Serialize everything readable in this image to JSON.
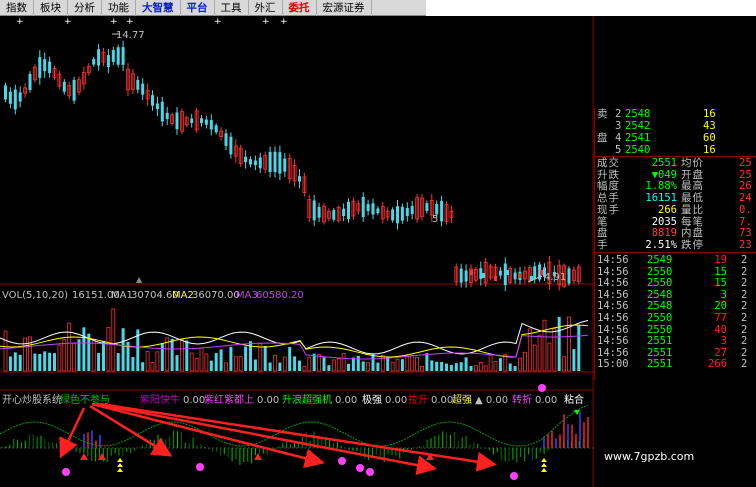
{
  "menu": [
    {
      "label": "指数",
      "style": "normal"
    },
    {
      "label": "板块",
      "style": "normal"
    },
    {
      "label": "分析",
      "style": "normal"
    },
    {
      "label": "功能",
      "style": "normal"
    },
    {
      "label": "大智慧",
      "style": "blue"
    },
    {
      "label": "平台",
      "style": "blue"
    },
    {
      "label": "工具",
      "style": "normal"
    },
    {
      "label": "外汇",
      "style": "normal"
    },
    {
      "label": "委托",
      "style": "red"
    },
    {
      "label": "宏源证券",
      "style": "normal"
    }
  ],
  "price_chart": {
    "high_label": "14.77",
    "low_label": "4.91",
    "small_label": "5"
  },
  "volume_panel": {
    "title": "VOL(5,10,20)",
    "vol_value": "16151.00",
    "ma1_label": "MA1",
    "ma1_value": "30704.60",
    "ma2_label": "MA2",
    "ma2_value": "36070.00",
    "ma3_label": "MA3",
    "ma3_value": "60580.20"
  },
  "indicator_panel": {
    "name": "开心炒股系统",
    "items": [
      {
        "label": "绿色不参与",
        "value": "",
        "color": "#00c000"
      },
      {
        "label": "紫阳快牛",
        "value": "0.00",
        "color": "#c000c0"
      },
      {
        "label": "紫红紫都上",
        "value": "0.00",
        "color": "#ff40ff"
      },
      {
        "label": "升浪超强机",
        "value": "0.00",
        "color": "#00ff00"
      },
      {
        "label": "极强",
        "value": "0.00",
        "color": "#ffffff"
      },
      {
        "label": "拉升",
        "value": "0.00",
        "color": "#ff0000"
      },
      {
        "label": "超强",
        "value": "▲ 0.00",
        "color": "#ffff00"
      },
      {
        "label": "转折",
        "value": "0.00",
        "color": "#ff40ff"
      },
      {
        "label": "粘合",
        "value": "",
        "color": "#ffffff"
      }
    ]
  },
  "orderbook": [
    {
      "side": "卖",
      "level": "2",
      "price": "2548",
      "vol": "16"
    },
    {
      "side": "",
      "level": "3",
      "price": "2542",
      "vol": "43"
    },
    {
      "side": "盘",
      "level": "4",
      "price": "2541",
      "vol": "60"
    },
    {
      "side": "",
      "level": "5",
      "price": "2540",
      "vol": "16"
    }
  ],
  "quote": [
    {
      "l": "成交",
      "v": "2551",
      "vc": "#00ff00",
      "l2": "均价",
      "v2": "25"
    },
    {
      "l": "升跌",
      "v": "▼049",
      "vc": "#00ff00",
      "l2": "开盘",
      "v2": "25"
    },
    {
      "l": "幅度",
      "v": "1.88%",
      "vc": "#00ff00",
      "l2": "最高",
      "v2": "26"
    },
    {
      "l": "总手",
      "v": "16151",
      "vc": "#00ffff",
      "l2": "最低",
      "v2": "24"
    },
    {
      "l": "现手",
      "v": "266",
      "vc": "#ffff00",
      "l2": "量比",
      "v2": "0."
    },
    {
      "l": "笔",
      "v": "2035",
      "vc": "#ffffff",
      "l2": "每笔",
      "v2": "7."
    },
    {
      "l": "盘",
      "v": "8819",
      "vc": "#ff4040",
      "l2": "内盘",
      "v2": "73"
    },
    {
      "l": "手",
      "v": "2.51%",
      "vc": "#ffffff",
      "l2": "跌停",
      "v2": "23"
    }
  ],
  "ticks": [
    {
      "t": "14:56",
      "p": "2549",
      "v": "19",
      "vc": "#ff2020",
      "d": "2"
    },
    {
      "t": "14:56",
      "p": "2550",
      "v": "15",
      "vc": "#00ff00",
      "d": "2"
    },
    {
      "t": "14:56",
      "p": "2550",
      "v": "15",
      "vc": "#00ff00",
      "d": "2"
    },
    {
      "t": "14:56",
      "p": "2548",
      "v": "3",
      "vc": "#00ff00",
      "d": "2"
    },
    {
      "t": "14:56",
      "p": "2548",
      "v": "20",
      "vc": "#00ff00",
      "d": "2"
    },
    {
      "t": "14:56",
      "p": "2550",
      "v": "77",
      "vc": "#ff2020",
      "d": "2"
    },
    {
      "t": "14:56",
      "p": "2550",
      "v": "40",
      "vc": "#ff2020",
      "d": "2"
    },
    {
      "t": "14:56",
      "p": "2551",
      "v": "3",
      "vc": "#ff2020",
      "d": "2"
    },
    {
      "t": "14:56",
      "p": "2551",
      "v": "27",
      "vc": "#ff2020",
      "d": "2"
    },
    {
      "t": "15:00",
      "p": "2551",
      "v": "266",
      "vc": "#ff2020",
      "d": "2"
    }
  ],
  "watermark": "www.7gpzb.com",
  "colors": {
    "up": "#ff3030",
    "down": "#4ad7e8",
    "ma_yellow": "#ffff00",
    "ma_purple": "#c040ff",
    "grid": "#8b0000",
    "arrow": "#ff2020"
  }
}
